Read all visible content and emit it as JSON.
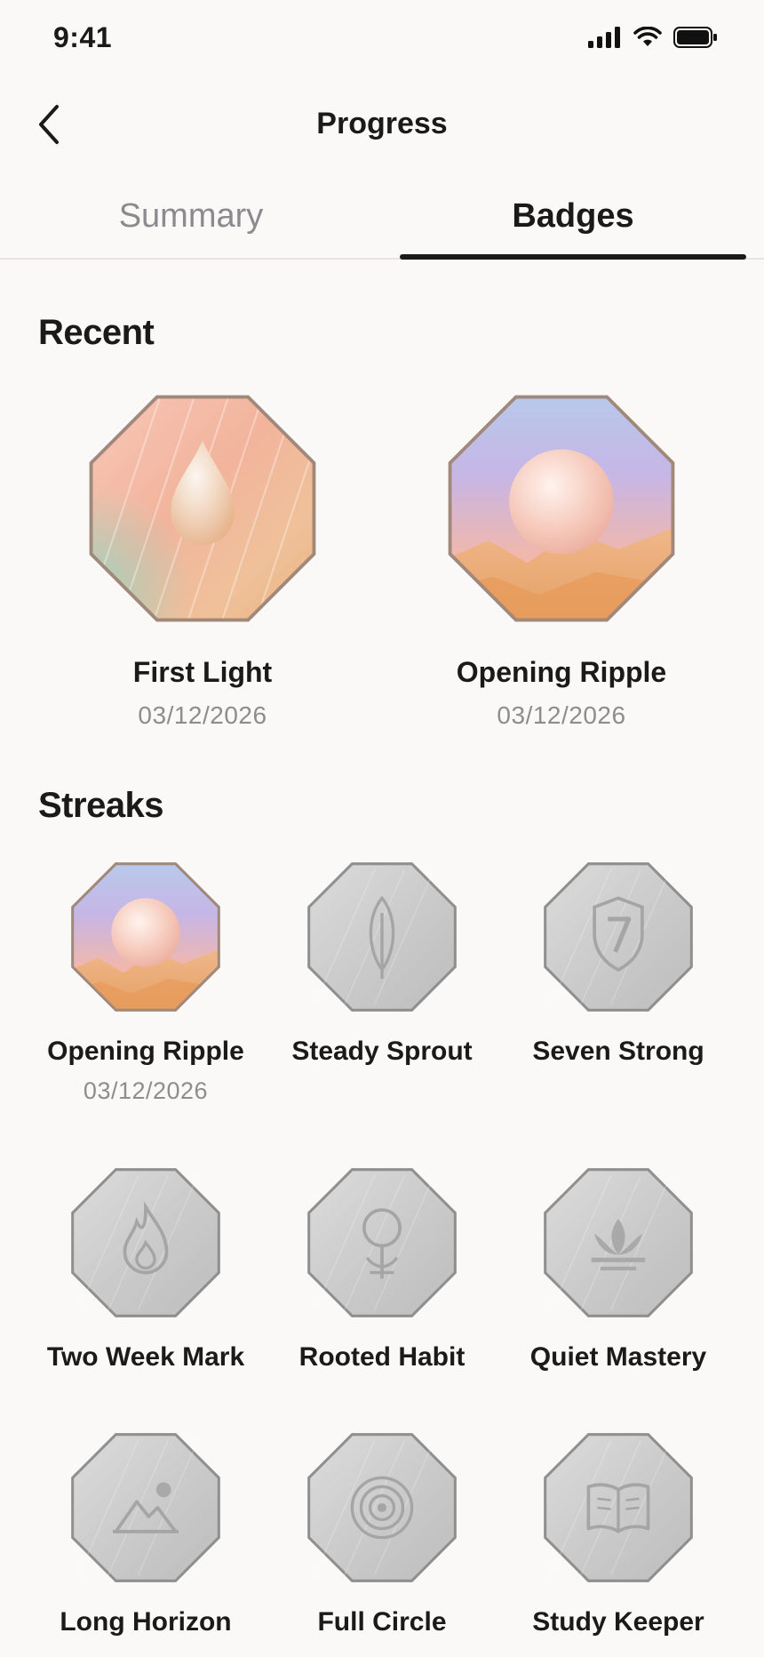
{
  "status_bar": {
    "time": "9:41",
    "icons": [
      "signal-icon",
      "wifi-icon",
      "battery-icon"
    ]
  },
  "nav": {
    "back_icon": "chevron-left-icon",
    "title": "Progress"
  },
  "tabs": [
    {
      "label": "Summary",
      "selected": false
    },
    {
      "label": "Badges",
      "selected": true
    }
  ],
  "sections": {
    "recent_title": "Recent",
    "streaks_title": "Streaks"
  },
  "recent": [
    {
      "name": "First Light",
      "date": "03/12/2026",
      "icon": "droplet-icon",
      "earned": true
    },
    {
      "name": "Opening Ripple",
      "date": "03/12/2026",
      "icon": "sun-over-dunes-icon",
      "earned": true
    }
  ],
  "streaks": [
    {
      "name": "Opening Ripple",
      "date": "03/12/2026",
      "icon": "sun-over-dunes-icon",
      "earned": true
    },
    {
      "name": "Steady Sprout",
      "icon": "leaf-icon",
      "earned": false
    },
    {
      "name": "Seven Strong",
      "icon": "shield-seven-icon",
      "earned": false
    },
    {
      "name": "Two Week Mark",
      "icon": "flame-icon",
      "earned": false
    },
    {
      "name": "Rooted Habit",
      "icon": "sprout-roots-icon",
      "earned": false
    },
    {
      "name": "Quiet Mastery",
      "icon": "lotus-icon",
      "earned": false
    },
    {
      "name": "Long Horizon",
      "icon": "mountain-icon",
      "earned": false
    },
    {
      "name": "Full Circle",
      "icon": "concentric-circles-icon",
      "earned": false
    },
    {
      "name": "Study Keeper",
      "icon": "open-book-icon",
      "earned": false
    }
  ],
  "colors": {
    "background": "#faf9f8",
    "text": "#1a1a1a",
    "muted": "#8e8c8c",
    "locked_badge": "#c9c9c9"
  }
}
